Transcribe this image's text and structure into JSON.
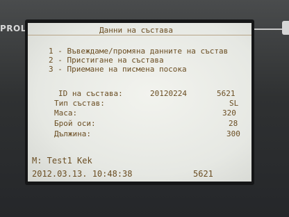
{
  "device": {
    "brand": "PROLAN"
  },
  "screen": {
    "title": "Данни на състава",
    "menu": [
      "1 - Въвеждаме/промяна данните на състав",
      "2 - Пристигане на състава",
      "3 - Приемане на писмена посока"
    ],
    "fields": {
      "id_label": "ID на състава:",
      "id_value1": "20120224",
      "id_value2": "5621",
      "type_label": "Тип състав:",
      "type_value": "SL",
      "mass_label": "Маса:",
      "mass_value": "320",
      "axles_label": "Брой оси:",
      "axles_value": "28",
      "length_label": "Дължина:",
      "length_value": "300"
    },
    "footer": {
      "user": "M: Test1 Kek",
      "datetime": "2012.03.13. 10:48:38",
      "code": "5621"
    }
  }
}
